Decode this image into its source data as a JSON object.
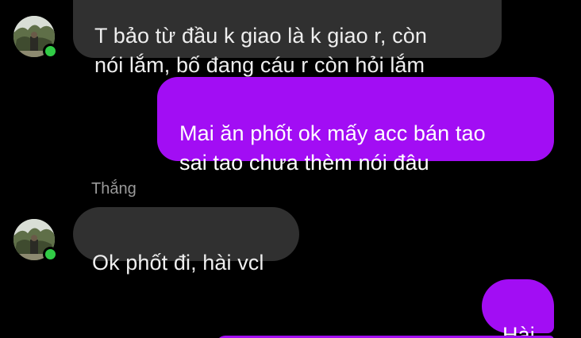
{
  "conversation": {
    "messages": [
      {
        "direction": "incoming",
        "text": "T bảo từ đầu k giao là k giao r, còn\nnói lắm, bố đang cáu r còn hỏi lắm"
      },
      {
        "direction": "outgoing",
        "text": "Mai ăn phốt ok mấy acc bán tao\nsai tao chưa thèm nói đâu"
      },
      {
        "direction": "incoming",
        "sender": "Thắng",
        "text": "Ok phốt đi, hài vcl"
      },
      {
        "direction": "outgoing",
        "text": "Hài"
      }
    ]
  },
  "colors": {
    "background": "#000000",
    "incoming_bubble": "#303030",
    "outgoing_bubble": "#a20df4",
    "online_status": "#31cc46",
    "sender_name": "#9a9a9a"
  },
  "icons": {
    "avatar": "contact-avatar-photo",
    "status": "online-status-dot"
  }
}
